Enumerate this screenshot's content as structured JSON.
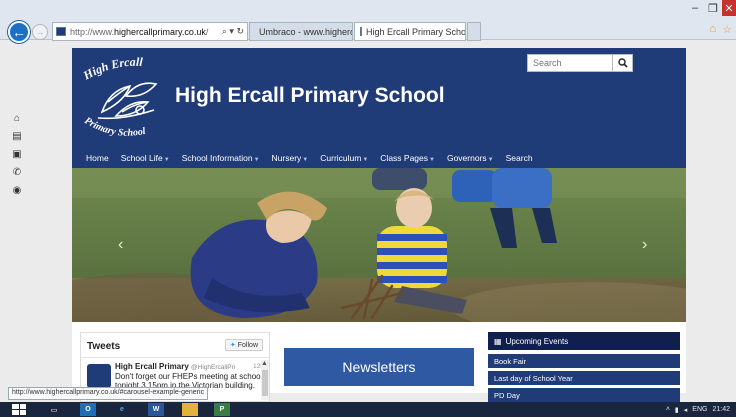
{
  "browser": {
    "address_prefix": "http://www.",
    "address_domain": "highercallprimary.co.uk",
    "address_suffix": "/",
    "tabs": [
      {
        "label": "Umbraco - www.highercallpri..."
      },
      {
        "label": "High Ercall Primary School"
      }
    ],
    "tab_close": "×",
    "status_url": "http://www.highercallprimary.co.uk/#carousel-example-generic"
  },
  "site": {
    "logo_top": "High Ercall",
    "logo_bottom": "Primary School",
    "title": "High Ercall Primary School",
    "search_placeholder": "Search",
    "nav": [
      {
        "label": "Home",
        "dropdown": false
      },
      {
        "label": "School Life",
        "dropdown": true
      },
      {
        "label": "School Information",
        "dropdown": true
      },
      {
        "label": "Nursery",
        "dropdown": true
      },
      {
        "label": "Curriculum",
        "dropdown": true
      },
      {
        "label": "Class Pages",
        "dropdown": true
      },
      {
        "label": "Governors",
        "dropdown": true
      },
      {
        "label": "Search",
        "dropdown": false
      }
    ],
    "carousel": {
      "prev": "‹",
      "next": "›"
    },
    "tweets": {
      "title": "Tweets",
      "follow": "Follow",
      "name": "High Ercall Primary",
      "handle": "@HighErcallPri",
      "time": "12h",
      "text": "Don't forget our FHEPs meeting at school tonight 3.15pm in the Victorian building. Film club available."
    },
    "newsletters": "Newsletters",
    "events": {
      "heading": "Upcoming Events",
      "items": [
        "Book Fair",
        "Last day of School Year",
        "PD Day"
      ]
    }
  },
  "taskbar": {
    "lang": "ENG",
    "time": "21:42"
  },
  "colors": {
    "header": "#1f3b78",
    "events_head": "#101f4d",
    "newsletters": "#2f5aa3",
    "close_red": "#c7312b"
  }
}
